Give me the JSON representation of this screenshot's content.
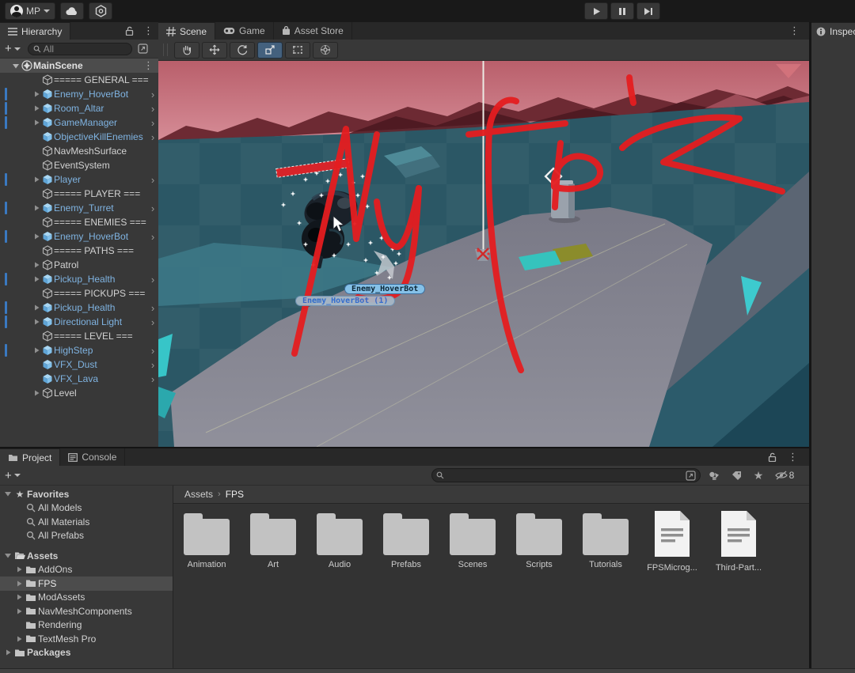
{
  "topbar": {
    "account_label": "MP",
    "cloud_icon": "cloud-icon",
    "version_control_icon": "plastic-scm-icon",
    "play_controls": [
      "play",
      "pause",
      "step"
    ]
  },
  "hierarchy": {
    "tab": "Hierarchy",
    "add_button": "+",
    "search_placeholder": "All",
    "root": {
      "label": "MainScene"
    },
    "items": [
      {
        "label": "===== GENERAL ===",
        "type": "plain",
        "bar": false,
        "exp": false,
        "arrow": false
      },
      {
        "label": "Enemy_HoverBot",
        "type": "prefab",
        "bar": true,
        "exp": true,
        "arrow": true
      },
      {
        "label": "Room_Altar",
        "type": "prefab",
        "bar": true,
        "exp": true,
        "arrow": true
      },
      {
        "label": "GameManager",
        "type": "prefab",
        "bar": true,
        "exp": true,
        "arrow": true
      },
      {
        "label": "ObjectiveKillEnemies",
        "type": "prefab",
        "bar": false,
        "exp": false,
        "arrow": true
      },
      {
        "label": "NavMeshSurface",
        "type": "plain",
        "bar": false,
        "exp": false,
        "arrow": false
      },
      {
        "label": "EventSystem",
        "type": "plain",
        "bar": false,
        "exp": false,
        "arrow": false
      },
      {
        "label": "Player",
        "type": "prefab",
        "bar": true,
        "exp": true,
        "arrow": true
      },
      {
        "label": "===== PLAYER ===",
        "type": "plain",
        "bar": false,
        "exp": false,
        "arrow": false
      },
      {
        "label": "Enemy_Turret",
        "type": "prefab",
        "bar": true,
        "exp": true,
        "arrow": true
      },
      {
        "label": "===== ENEMIES ===",
        "type": "plain",
        "bar": false,
        "exp": false,
        "arrow": false
      },
      {
        "label": "Enemy_HoverBot",
        "type": "prefab",
        "bar": true,
        "exp": true,
        "arrow": true
      },
      {
        "label": "===== PATHS ===",
        "type": "plain",
        "bar": false,
        "exp": false,
        "arrow": false
      },
      {
        "label": "Patrol",
        "type": "plain",
        "bar": false,
        "exp": true,
        "arrow": false
      },
      {
        "label": "Pickup_Health",
        "type": "prefab",
        "bar": true,
        "exp": true,
        "arrow": true
      },
      {
        "label": "===== PICKUPS ===",
        "type": "plain",
        "bar": false,
        "exp": false,
        "arrow": false
      },
      {
        "label": "Pickup_Health",
        "type": "prefab",
        "bar": true,
        "exp": true,
        "arrow": true
      },
      {
        "label": "Directional Light",
        "type": "prefab",
        "bar": true,
        "exp": true,
        "arrow": true
      },
      {
        "label": "===== LEVEL ===",
        "type": "plain",
        "bar": false,
        "exp": false,
        "arrow": false
      },
      {
        "label": "HighStep",
        "type": "prefab",
        "bar": true,
        "exp": true,
        "arrow": true
      },
      {
        "label": "VFX_Dust",
        "type": "prefab",
        "bar": false,
        "exp": false,
        "arrow": true
      },
      {
        "label": "VFX_Lava",
        "type": "prefab",
        "bar": false,
        "exp": false,
        "arrow": true
      },
      {
        "label": "Level",
        "type": "plain",
        "bar": false,
        "exp": true,
        "arrow": false
      }
    ]
  },
  "scene_view": {
    "tabs": [
      {
        "label": "Scene"
      },
      {
        "label": "Game"
      },
      {
        "label": "Asset Store"
      }
    ],
    "tools": [
      "hand",
      "move",
      "rotate",
      "scale",
      "rect",
      "transform"
    ],
    "active_tool": "scale",
    "object_labels": [
      "Enemy_HoverBot",
      "Enemy_HoverBot (1)"
    ],
    "annotation_text": "My fps",
    "annotation_color": "#e51d20"
  },
  "inspector": {
    "tab": "Inspector"
  },
  "project": {
    "tabs": [
      {
        "label": "Project"
      },
      {
        "label": "Console"
      }
    ],
    "add_button": "+",
    "search_placeholder": "",
    "hidden_count": "8",
    "breadcrumb": [
      "Assets",
      "FPS"
    ],
    "tree": [
      {
        "label": "Favorites",
        "depth": 0,
        "icon": "star",
        "exp": "open",
        "bold": true
      },
      {
        "label": "All Models",
        "depth": 1,
        "icon": "search",
        "exp": "none",
        "bold": false
      },
      {
        "label": "All Materials",
        "depth": 1,
        "icon": "search",
        "exp": "none",
        "bold": false
      },
      {
        "label": "All Prefabs",
        "depth": 1,
        "icon": "search",
        "exp": "none",
        "bold": false
      },
      {
        "label": "",
        "depth": 0,
        "icon": "none",
        "exp": "none",
        "bold": false
      },
      {
        "label": "Assets",
        "depth": 0,
        "icon": "folder-open",
        "exp": "open",
        "bold": true
      },
      {
        "label": "AddOns",
        "depth": 1,
        "icon": "folder",
        "exp": "closed",
        "bold": false
      },
      {
        "label": "FPS",
        "depth": 1,
        "icon": "folder",
        "exp": "closed",
        "bold": false,
        "selected": true
      },
      {
        "label": "ModAssets",
        "depth": 1,
        "icon": "folder",
        "exp": "closed",
        "bold": false
      },
      {
        "label": "NavMeshComponents",
        "depth": 1,
        "icon": "folder",
        "exp": "closed",
        "bold": false
      },
      {
        "label": "Rendering",
        "depth": 1,
        "icon": "folder",
        "exp": "none",
        "bold": false
      },
      {
        "label": "TextMesh Pro",
        "depth": 1,
        "icon": "folder",
        "exp": "closed",
        "bold": false
      },
      {
        "label": "Packages",
        "depth": 0,
        "icon": "folder",
        "exp": "closed",
        "bold": true
      }
    ],
    "grid": [
      {
        "label": "Animation",
        "kind": "folder"
      },
      {
        "label": "Art",
        "kind": "folder"
      },
      {
        "label": "Audio",
        "kind": "folder"
      },
      {
        "label": "Prefabs",
        "kind": "folder"
      },
      {
        "label": "Scenes",
        "kind": "folder"
      },
      {
        "label": "Scripts",
        "kind": "folder"
      },
      {
        "label": "Tutorials",
        "kind": "folder"
      },
      {
        "label": "FPSMicrog...",
        "kind": "doc"
      },
      {
        "label": "Third-Part...",
        "kind": "doc"
      }
    ]
  },
  "colors": {
    "prefab_blue": "#7fb3e1",
    "override_bar_blue": "#3a79c1",
    "selection_gray": "#4c4c4c",
    "annotation_red": "#e51d20",
    "sky_pink": "#c16b74",
    "wall_teal": "#2b5765",
    "floor_gray": "#8a8a96"
  }
}
